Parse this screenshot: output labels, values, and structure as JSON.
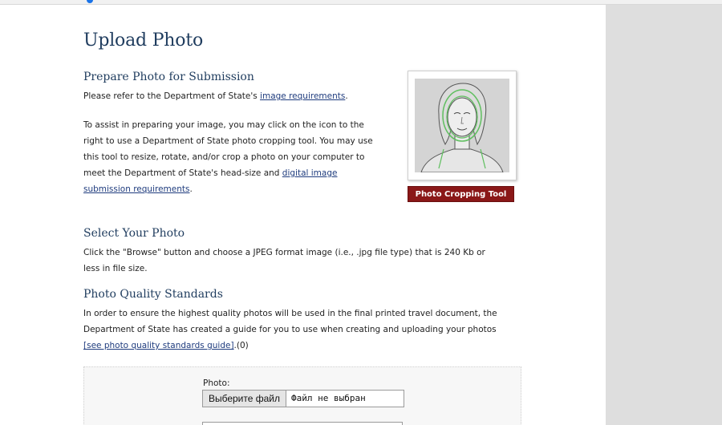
{
  "page": {
    "title": "Upload Photo"
  },
  "prepare": {
    "heading": "Prepare Photo for Submission",
    "line1_prefix": "Please refer to the Department of State's ",
    "line1_link": "image requirements",
    "line1_suffix": ".",
    "para_lines": [
      "To assist in preparing your image, you may click on the icon to the",
      "right to use a Department of State photo cropping tool. You may use",
      "this tool to resize, rotate, and/or crop a photo on your computer to",
      "meet the Department of State's head-size and "
    ],
    "digital_link_part1": "digital image",
    "digital_link_part2": "submission requirements",
    "digital_suffix": ".",
    "tool_button": "Photo Cropping Tool"
  },
  "select": {
    "heading": "Select Your Photo",
    "line1": "Click the \"Browse\" button and choose a JPEG format image (i.e., .jpg file type) that is 240 Kb or",
    "line2": "less in file size."
  },
  "quality": {
    "heading": "Photo Quality Standards",
    "line1": "In order to ensure the highest quality photos will be used in the final printed travel document, the",
    "line2": "Department of State has created a guide for you to use when creating and uploading your photos",
    "link": "[see photo quality standards guide]",
    "suffix": ".(0)"
  },
  "upload": {
    "label": "Photo:",
    "choose_button": "Выберите файл",
    "status": "Файл не выбран"
  },
  "colors": {
    "heading": "#1f3c5e",
    "button_red": "#8a1717",
    "side_panel": "#dedede"
  }
}
